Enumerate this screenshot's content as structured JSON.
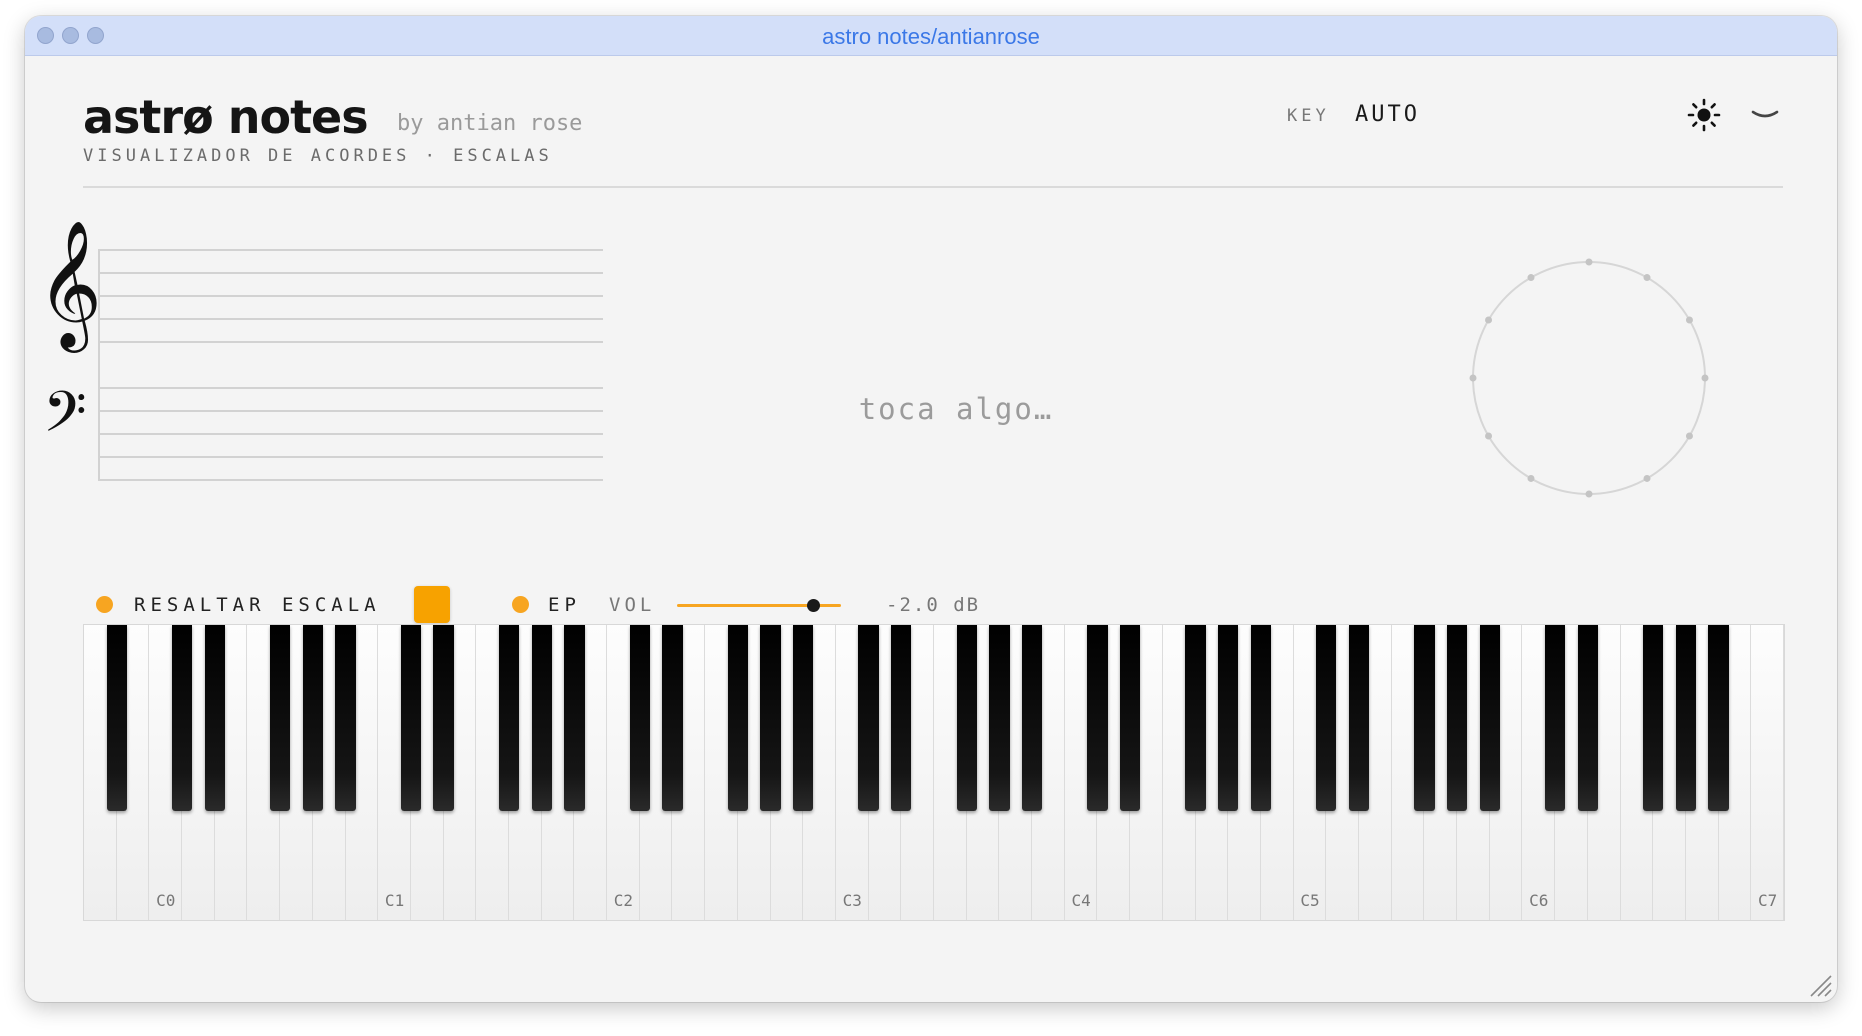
{
  "window": {
    "title": "astro notes/antianrose"
  },
  "header": {
    "logo": "astrø notes",
    "byline": "by antian rose",
    "subtitle": "VISUALIZADOR DE ACORDES · ESCALAS",
    "key_label": "KEY",
    "key_value": "AUTO",
    "theme_icon": "sun-icon",
    "menu_icon": "chevron-down-icon"
  },
  "staff": {
    "treble_clef": "𝄞",
    "bass_clef": "𝄢"
  },
  "display": {
    "empty_message": "toca algo…"
  },
  "circle": {
    "points": 12
  },
  "controls": {
    "highlight_scale_label": "RESALTAR ESCALA",
    "highlight_color": "#f7a200",
    "instrument_label": "EP",
    "volume_label": "VOL",
    "volume_fraction": 0.83,
    "volume_readout": "-2.0 dB",
    "accent_color": "#f7a521"
  },
  "keyboard": {
    "white_keys": 52,
    "first_note": "A",
    "octave_labels": [
      "C0",
      "C1",
      "C2",
      "C3",
      "C4",
      "C5",
      "C6",
      "C7"
    ]
  }
}
